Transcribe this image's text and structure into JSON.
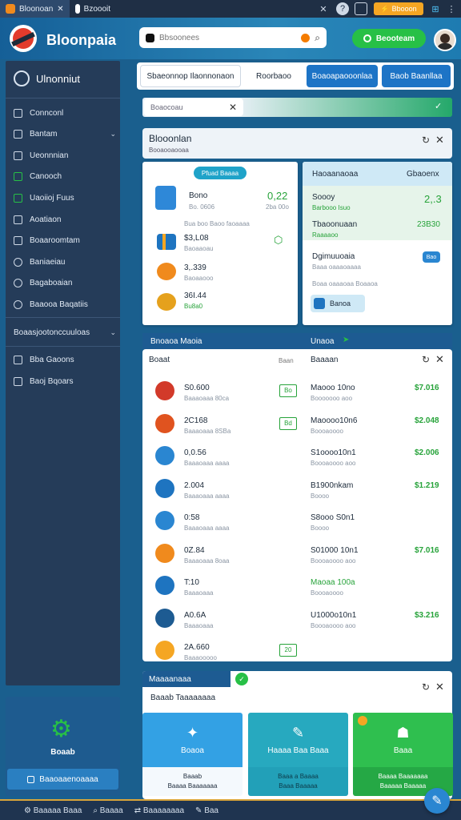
{
  "tabs": [
    {
      "label": "Bloonoan"
    },
    {
      "label": "Bzoooit"
    }
  ],
  "topbar": {
    "badge": "Bbooon",
    "brand": "Bloonpaia",
    "search_placeholder": "Bbsoonees",
    "cta": "Beooteam"
  },
  "sidebar": {
    "title": "Ulnonniut",
    "items": [
      {
        "label": "Connconl"
      },
      {
        "label": "Bantam",
        "chevron": true
      },
      {
        "label": "Ueonnnian"
      },
      {
        "label": "Canooch"
      },
      {
        "label": "Uaoiioj Fuus"
      },
      {
        "label": "Aoatiaon"
      },
      {
        "label": "Boaaroomtam"
      },
      {
        "label": "Baniaeiau"
      },
      {
        "label": "Bagaboaian"
      },
      {
        "label": "Baaooa Baqatiis"
      }
    ],
    "section": "Boaasjootonccuuloas",
    "extras": [
      {
        "label": "Bba Gaoons"
      },
      {
        "label": "Baoj Bqoars"
      }
    ],
    "bottom": {
      "label": "Boaab",
      "button": "Baaoaaenoaaaa"
    }
  },
  "toolbar": {
    "pills": [
      "Sbaeonnop Ilaonnonaon",
      "Roorbaoo",
      "Boaoapaooonlaa",
      "Baob Baanllaa"
    ]
  },
  "filter": {
    "value": "Boaocoau"
  },
  "main_panel": {
    "title": "Blooonlan",
    "subtitle": "Booaooaooaa"
  },
  "left_card": {
    "chip": "Pfuad Baaaa",
    "items": [
      {
        "label": "Bono",
        "sub": "Bo. 0606",
        "value": "0,22",
        "value_sub": "2ba 00o"
      },
      {
        "label": "Bua boo Baoo faoaaaa",
        "sub": "",
        "value": "",
        "value_sub": ""
      },
      {
        "label": "$3,L08",
        "sub": "Baoaaoau",
        "value": "",
        "value_sub": ""
      },
      {
        "label": "3,.339",
        "sub": "Baoaaooo",
        "value": "",
        "value_sub": ""
      },
      {
        "label": "36I.44",
        "sub": "Bu8a0",
        "value": "",
        "value_sub": ""
      }
    ]
  },
  "right_card": {
    "header_left": "Haoaanaoaa",
    "header_right": "Gbaoenx",
    "row1": {
      "label": "Soooy",
      "sub": "Barbooo Isuo",
      "value": "2,.3"
    },
    "row2": {
      "label": "Tbaoonuaan",
      "sub": "Raaaaoo",
      "value": "23B30"
    },
    "row3": {
      "label": "Dgimuuoaia",
      "sub": "Baaa oaaaoaaaa",
      "chip": "Bao"
    },
    "row4": {
      "sub": "Boaa oaaaoaa Boaaoa"
    },
    "button": "Banoa"
  },
  "list_header": {
    "left": "Bnoaoa Maoia",
    "right": "Unaoa"
  },
  "list_colhdr": {
    "left": "Boaat",
    "mid": "Baan",
    "right": "Baaaan"
  },
  "list_left": [
    {
      "value": "S0.600",
      "sub": "Baaaoaaa 80ca",
      "tag": "Bo"
    },
    {
      "value": "2C168",
      "sub": "Baaaoaaa 8SBa",
      "tag": "Bd"
    },
    {
      "value": "0,0.56",
      "sub": "Baaaoaaa aaaa",
      "tag": ""
    },
    {
      "value": "2.004",
      "sub": "Baaaoaaa aaaa",
      "tag": ""
    },
    {
      "value": "0:58",
      "sub": "Baaaoaaa aaaa",
      "tag": ""
    },
    {
      "value": "0Z.84",
      "sub": "Baaaoaaa 8oaa",
      "tag": ""
    },
    {
      "value": "T:10",
      "sub": "Baaaoaaa",
      "tag": ""
    },
    {
      "value": "A0.6A",
      "sub": "Baaaoaaa",
      "tag": ""
    },
    {
      "value": "2A.660",
      "sub": "Baaaooooo",
      "tag": "20"
    }
  ],
  "list_right": [
    {
      "name": "Maooo 10no",
      "sub": "Booooooo aoo",
      "amount": "$7.016",
      "g": true
    },
    {
      "name": "Maoooo10n6",
      "sub": "Boooaoooo",
      "amount": "$2.048",
      "g": true
    },
    {
      "name": "S1oooo10n1",
      "sub": "Boooaoooo aoo",
      "amount": "$2.006",
      "g": true
    },
    {
      "name": "B1900nkam",
      "sub": "Boooo",
      "amount": "$1.219",
      "g": true
    },
    {
      "name": "S8ooo S0n1",
      "sub": "Boooo",
      "amount": "",
      "g": false
    },
    {
      "name": "S01000 10n1",
      "sub": "Boooaoooo aoo",
      "amount": "$7.016",
      "g": true
    },
    {
      "name": "Maoaa 100a",
      "sub": "Boooaoooo",
      "amount": "",
      "g": true
    },
    {
      "name": "U1000o10n1",
      "sub": "Boooaoooo aoo",
      "amount": "$3.216",
      "g": true
    }
  ],
  "bottom_panel": {
    "tab": "Maaaanaaa",
    "title": "Baaab Taaaaaaaa",
    "cards": [
      {
        "label": "Boaoa",
        "line1": "Baaab",
        "line2": "Baaaa Baaaaaaa"
      },
      {
        "label": "Haaaa Baa Baaa",
        "line1": "Baaa a Baaaa",
        "line2": "Baaa Baaaaa"
      },
      {
        "label": "Baaa",
        "line1": "Baaaa Baaaaaaa",
        "line2": "Baaaaa Baaaaa"
      }
    ]
  },
  "statusbar": {
    "items": [
      "Baaaaa Baaa",
      "Baaaa",
      "Baaaaaaaa",
      "Baa"
    ]
  },
  "colors": {
    "accent": "#27c046",
    "primary": "#1e74c0",
    "sidebar": "#253c59"
  }
}
